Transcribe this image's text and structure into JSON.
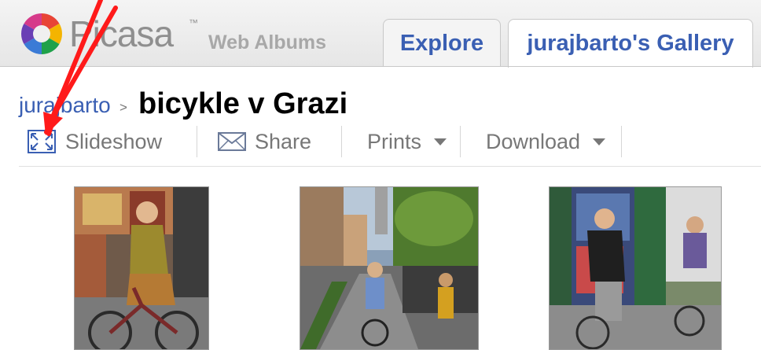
{
  "header": {
    "brand_name": "Picasa",
    "brand_tm": "™",
    "brand_subtitle": "Web Albums",
    "tabs": [
      {
        "label": "Explore",
        "active": false
      },
      {
        "label": "jurajbarto's Gallery",
        "active": true
      }
    ]
  },
  "breadcrumb": {
    "user": "jurajbarto",
    "separator": ">",
    "album_title": "bicykle v Grazi"
  },
  "toolbar": {
    "slideshow": {
      "label": "Slideshow",
      "icon": "fullscreen-icon"
    },
    "share": {
      "label": "Share",
      "icon": "envelope-icon"
    },
    "prints": {
      "label": "Prints",
      "icon": "dropdown-caret-icon"
    },
    "download": {
      "label": "Download",
      "icon": "dropdown-caret-icon"
    }
  },
  "colors": {
    "link": "#3a5fb3",
    "annotation_arrow": "#ff1a1a"
  },
  "photos": [
    {
      "name": "photo-woman-cyclist-market"
    },
    {
      "name": "photo-bike-lane-street"
    },
    {
      "name": "photo-men-walking-bikes"
    }
  ]
}
